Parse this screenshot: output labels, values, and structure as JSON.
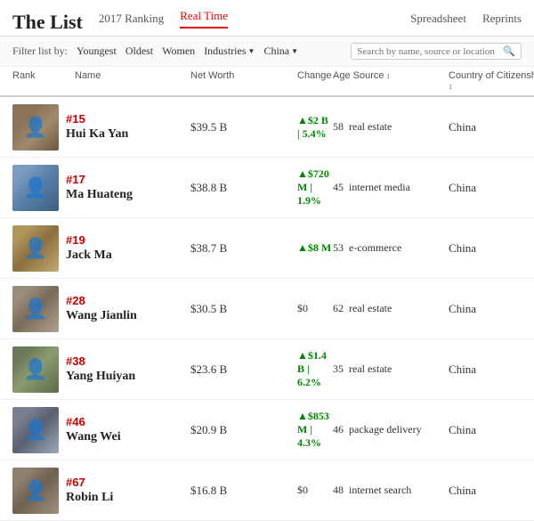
{
  "header": {
    "title": "The List",
    "nav": [
      {
        "label": "2017 Ranking",
        "active": false
      },
      {
        "label": "Real Time",
        "active": true
      }
    ],
    "right": [
      {
        "label": "Spreadsheet"
      },
      {
        "label": "Reprints"
      }
    ]
  },
  "filter": {
    "label": "Filter list by:",
    "items": [
      "Youngest",
      "Oldest",
      "Women"
    ],
    "dropdowns": [
      "Industries",
      "China"
    ],
    "search_placeholder": "Search by name, source or location"
  },
  "table": {
    "columns": [
      "Rank",
      "Name",
      "Net Worth",
      "Change",
      "Age Source",
      "Country of Citizenship"
    ],
    "rows": [
      {
        "rank": "#15",
        "name": "Hui Ka Yan",
        "net_worth": "$39.5 B",
        "change": "▲$2 B | 5.4%",
        "age": "58",
        "source": "real estate",
        "country": "China"
      },
      {
        "rank": "#17",
        "name": "Ma Huateng",
        "net_worth": "$38.8 B",
        "change": "▲$720 M | 1.9%",
        "age": "45",
        "source": "internet media",
        "country": "China"
      },
      {
        "rank": "#19",
        "name": "Jack Ma",
        "net_worth": "$38.7 B",
        "change": "▲$8 M",
        "age": "53",
        "source": "e-commerce",
        "country": "China"
      },
      {
        "rank": "#28",
        "name": "Wang Jianlin",
        "net_worth": "$30.5 B",
        "change": "$0",
        "age": "62",
        "source": "real estate",
        "country": "China"
      },
      {
        "rank": "#38",
        "name": "Yang Huiyan",
        "net_worth": "$23.6 B",
        "change": "▲$1.4 B | 6.2%",
        "age": "35",
        "source": "real estate",
        "country": "China"
      },
      {
        "rank": "#46",
        "name": "Wang Wei",
        "net_worth": "$20.9 B",
        "change": "▲$853 M | 4.3%",
        "age": "46",
        "source": "package delivery",
        "country": "China"
      },
      {
        "rank": "#67",
        "name": "Robin Li",
        "net_worth": "$16.8 B",
        "change": "$0",
        "age": "48",
        "source": "internet search",
        "country": "China"
      }
    ]
  }
}
